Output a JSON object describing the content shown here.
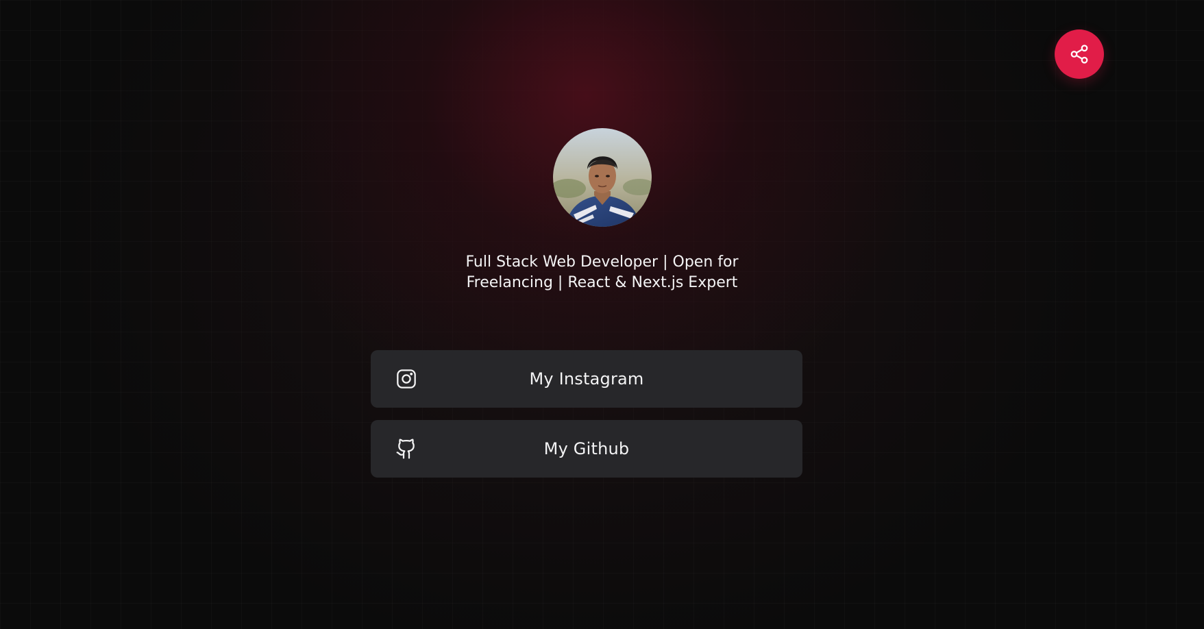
{
  "share": {
    "icon": "share-icon",
    "color": "#e11d48"
  },
  "profile": {
    "avatar_icon": "avatar",
    "bio": "Full Stack Web Developer | Open for Freelancing | React & Next.js Expert"
  },
  "links": [
    {
      "label": "My Instagram",
      "icon": "instagram-icon"
    },
    {
      "label": "My Github",
      "icon": "github-icon"
    }
  ],
  "colors": {
    "background": "#0b0b0b",
    "card": "#27272a",
    "accent": "#e11d48",
    "glow": "#560e1c"
  }
}
